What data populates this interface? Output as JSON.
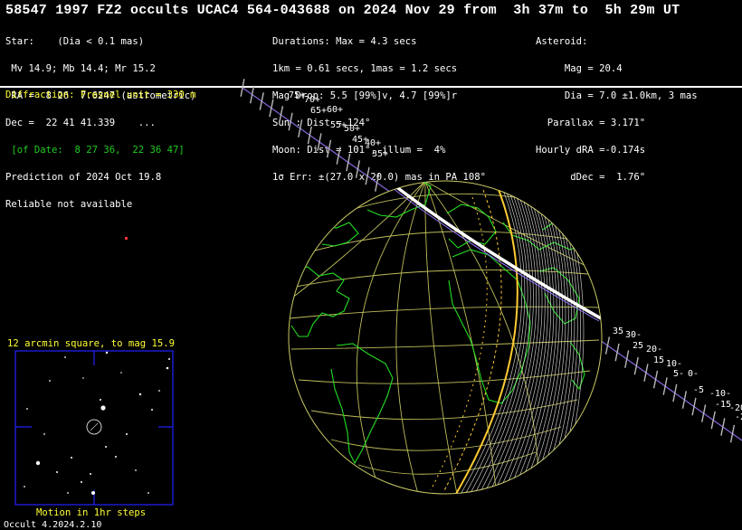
{
  "title": "58547 1997 FZ2 occults UCAC4 564-043688 on 2024 Nov 29 from  3h 37m to  5h 29m UT",
  "star_block": [
    "Star:    (Dia < 0.1 mas)",
    " Mv 14.9; Mb 14.4; Mr 15.2",
    " RA =  8 26  7.6247 (astrometric)",
    "Dec =  22 41 41.339    ...",
    " [of Date:  8 27 36,  22 36 47]",
    "Prediction of 2024 Oct 19.8",
    "Reliable not available"
  ],
  "event_block": [
    "Durations: Max = 4.3 secs",
    "1km = 0.61 secs, 1mas = 1.2 secs",
    "Mag Drop: 5.5 [99%]v, 4.7 [99%]r",
    "Sun : Dist = 124°",
    "Moon: Dist = 101°, illum =  4%",
    "1σ Err: ±(27.0 x 20.0) mas in PA 108°"
  ],
  "asteroid_block": [
    "Asteroid:",
    "     Mag = 20.4",
    "     Dia = 7.0 ±1.0km, 3 mas",
    "  Parallax = 3.171\"",
    "Hourly dRA =-0.174s",
    "      dDec =  1.76\""
  ],
  "diffraction_text": "Diffraction: Fresnel unit = 330 m",
  "starchart_title": "12 arcmin square, to mag 15.9",
  "motion_text": "Motion in 1hr steps",
  "version": "Occult 4.2024.2.10",
  "path_labels_upper": [
    "75+",
    "70+",
    "65+",
    "60+",
    "55+",
    "50+",
    "45+",
    "40+",
    "35+"
  ],
  "path_labels_lower": [
    "35",
    "30-",
    "25",
    "20-",
    "15",
    "10-",
    "5-",
    "0-",
    "-5",
    "-10-",
    "-15",
    "-20",
    "-2"
  ],
  "colors": {
    "background": "#000000",
    "text": "#ffffff",
    "highlight": "#ffff33",
    "date_green": "#22cc22",
    "coastline": "#22dd22",
    "grid": "#c8c864",
    "path_track": "#aa88ff",
    "shadow_edge": "#ffcc33"
  }
}
